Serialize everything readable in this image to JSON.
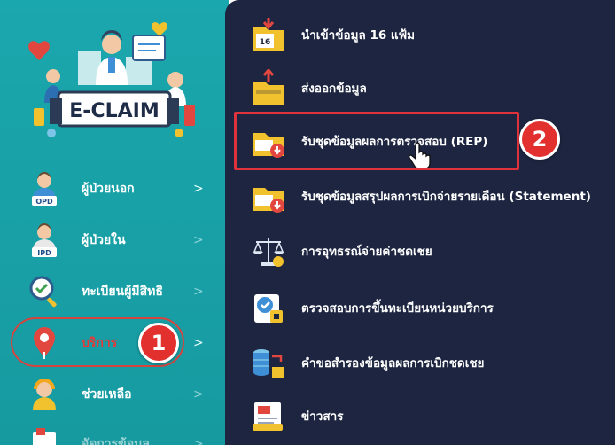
{
  "logo": {
    "text": "E-CLAIM"
  },
  "sidebar": {
    "items": [
      {
        "label": "ผู้ป่วยนอก",
        "icon": "opd-patient-icon",
        "icon_text": "OPD"
      },
      {
        "label": "ผู้ป่วยใน",
        "icon": "ipd-patient-icon",
        "icon_text": "IPD"
      },
      {
        "label": "ทะเบียนผู้มีสิทธิ",
        "icon": "registry-search-icon"
      },
      {
        "label": "บริการ",
        "icon": "location-pin-icon"
      },
      {
        "label": "ช่วยเหลือ",
        "icon": "support-agent-icon"
      },
      {
        "label": "จัดการข้อมูล",
        "icon": "data-management-icon"
      }
    ],
    "chevron": ">"
  },
  "flyout": {
    "items": [
      {
        "label": "นำเข้าข้อมูล 16 แฟ้ม",
        "icon": "import-folder-icon",
        "icon_text": "16"
      },
      {
        "label": "ส่งออกข้อมูล",
        "icon": "export-folder-icon"
      },
      {
        "label": "รับชุดข้อมูลผลการตรวจสอบ (REP)",
        "icon": "rep-folder-icon"
      },
      {
        "label": "รับชุดข้อมูลสรุปผลการเบิกจ่ายรายเดือน (Statement)",
        "icon": "statement-folder-icon"
      },
      {
        "label": "การอุทธรณ์จ่ายค่าชดเชย",
        "icon": "scale-balance-icon"
      },
      {
        "label": "ตรวจสอบการขึ้นทะเบียนหน่วยบริการ",
        "icon": "unit-registration-check-icon"
      },
      {
        "label": "คำขอสำรองข้อมูลผลการเบิกชดเชย",
        "icon": "database-backup-icon"
      },
      {
        "label": "ข่าวสาร",
        "icon": "news-icon"
      }
    ]
  },
  "annotations": {
    "step1": "1",
    "step2": "2"
  },
  "colors": {
    "sidebar": "#18a0a6",
    "flyout": "#1d2540",
    "highlight": "#e0323a",
    "folder": "#f2c12e"
  }
}
